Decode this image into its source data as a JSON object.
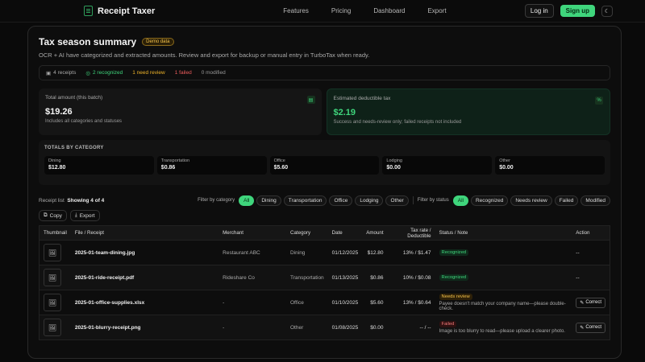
{
  "nav": {
    "brand": "Receipt Taxer",
    "menu": [
      "Features",
      "Pricing",
      "Dashboard",
      "Export"
    ],
    "login": "Log in",
    "signup": "Sign up",
    "theme_icon": "moon-icon"
  },
  "header": {
    "title": "Tax season summary",
    "badge": "Demo data",
    "subtitle": "OCR + AI have categorized and extracted amounts. Review and export for backup or manual entry in TurboTax when ready."
  },
  "stats": {
    "receipts": "4 receipts",
    "recognized": "2 recognized",
    "review": "1 need review",
    "failed": "1 failed",
    "modified": "0 modified"
  },
  "summary": {
    "total_label": "Total amount (this batch)",
    "total_value": "$19.26",
    "total_note": "Includes all categories and statuses",
    "deduct_label": "Estimated deductible tax",
    "deduct_value": "$2.19",
    "deduct_note": "Success and needs-review only; failed receipts not included"
  },
  "categories": {
    "title": "TOTALS BY CATEGORY",
    "items": [
      {
        "name": "Dining",
        "value": "$12.80"
      },
      {
        "name": "Transportation",
        "value": "$0.86"
      },
      {
        "name": "Office",
        "value": "$5.60"
      },
      {
        "name": "Lodging",
        "value": "$0.00"
      },
      {
        "name": "Other",
        "value": "$0.00"
      }
    ]
  },
  "filters": {
    "list_label": "Receipt list",
    "showing": "Showing 4 of 4",
    "category_label": "Filter by category",
    "category_chips": [
      "All",
      "Dining",
      "Transportation",
      "Office",
      "Lodging",
      "Other"
    ],
    "status_label": "Filter by status",
    "status_chips": [
      "All",
      "Recognized",
      "Needs review",
      "Failed",
      "Modified"
    ]
  },
  "tools": {
    "copy": "Copy",
    "export": "Export"
  },
  "table": {
    "headers": [
      "Thumbnail",
      "File / Receipt",
      "Merchant",
      "Category",
      "Date",
      "Amount",
      "Tax rate / Deductible",
      "Status / Note",
      "Action"
    ],
    "rows": [
      {
        "file": "2025-01-team-dining.jpg",
        "merchant": "Restaurant ABC",
        "category": "Dining",
        "date": "01/12/2025",
        "amount": "$12.80",
        "tax": "13% / $1.47",
        "status": "Recognized",
        "note": "",
        "action": "--"
      },
      {
        "file": "2025-01-ride-receipt.pdf",
        "merchant": "Rideshare Co",
        "category": "Transportation",
        "date": "01/13/2025",
        "amount": "$0.86",
        "tax": "10% / $0.08",
        "status": "Recognized",
        "note": "",
        "action": "--"
      },
      {
        "file": "2025-01-office-supplies.xlsx",
        "merchant": "-",
        "category": "Office",
        "date": "01/10/2025",
        "amount": "$5.60",
        "tax": "13% / $0.64",
        "status": "Needs review",
        "note": "Payee doesn't match your company name—please double-check.",
        "action": "Correct"
      },
      {
        "file": "2025-01-blurry-receipt.png",
        "merchant": "-",
        "category": "Other",
        "date": "01/08/2025",
        "amount": "$0.00",
        "tax": "-- / --",
        "status": "Failed",
        "note": "Image is too blurry to read—please upload a clearer photo.",
        "action": "Correct"
      }
    ]
  }
}
